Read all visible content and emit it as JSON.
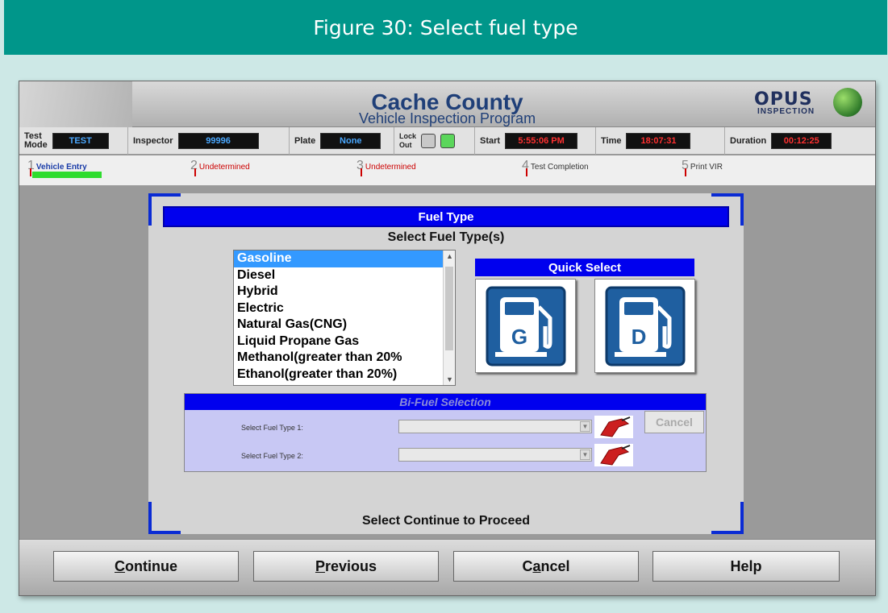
{
  "figure_caption": "Figure 30: Select fuel type",
  "app": {
    "title": "Cache County",
    "subtitle": "Vehicle Inspection Program",
    "logo_word": "OPUS",
    "logo_sub": "INSPECTION"
  },
  "status": {
    "test_mode_label_1": "Test",
    "test_mode_label_2": "Mode",
    "test_mode_value": "TEST",
    "inspector_label": "Inspector",
    "inspector_value": "99996",
    "plate_label": "Plate",
    "plate_value": "None",
    "lock_label_1": "Lock",
    "lock_label_2": "Out",
    "start_label": "Start",
    "start_value": "5:55:06 PM",
    "time_label": "Time",
    "time_value": "18:07:31",
    "duration_label": "Duration",
    "duration_value": "00:12:25"
  },
  "steps": [
    {
      "num": "1",
      "label": "Vehicle Entry",
      "color": "#1a3ca8"
    },
    {
      "num": "2",
      "label": "Undetermined",
      "color": "#cc0000"
    },
    {
      "num": "3",
      "label": "Undetermined",
      "color": "#cc0000"
    },
    {
      "num": "4",
      "label": "Test Completion",
      "color": "#333333"
    },
    {
      "num": "5",
      "label": "Print VIR",
      "color": "#333333"
    }
  ],
  "panel": {
    "heading": "Fuel Type",
    "subheading": "Select Fuel Type(s)",
    "fuel_options": [
      "Gasoline",
      "Diesel",
      "Hybrid",
      "Electric",
      "Natural Gas(CNG)",
      "Liquid Propane Gas",
      "Methanol(greater than 20%",
      "Ethanol(greater than 20%)"
    ],
    "selected_fuel": "Gasoline",
    "quick_select": "Quick Select",
    "pump_g_letter": "G",
    "pump_d_letter": "D",
    "bifuel_heading": "Bi-Fuel Selection",
    "bifuel_label_1": "Select Fuel Type 1:",
    "bifuel_label_2": "Select Fuel Type 2:",
    "bifuel_cancel": "Cancel",
    "proceed_text": "Select Continue to Proceed"
  },
  "buttons": {
    "continue_first": "C",
    "continue_rest": "ontinue",
    "previous_first": "P",
    "previous_rest": "revious",
    "cancel_pre": "C",
    "cancel_under": "a",
    "cancel_rest": "ncel",
    "help": "Help"
  },
  "colors": {
    "header_teal": "#00968a",
    "panel_blue": "#0000ee",
    "pump_blue": "#1f5fa0"
  }
}
